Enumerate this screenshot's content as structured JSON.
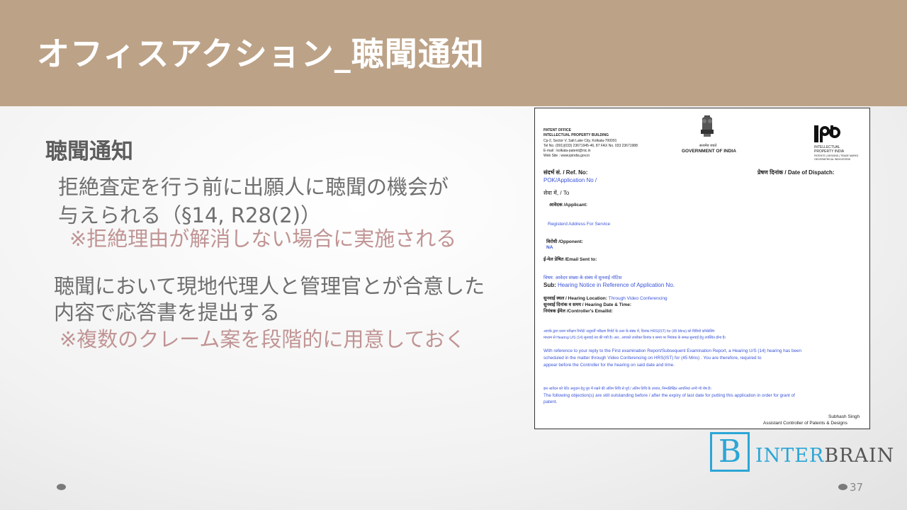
{
  "slide": {
    "title": "オフィスアクション_聴聞通知",
    "section_title": "聴聞通知",
    "body": {
      "line1": "拒絶査定を行う前に出願人に聴聞の機会が",
      "line2": "与えられる（§14, R28(2)）",
      "note1": "※拒絶理由が解消しない場合に実施される",
      "line3": "聴聞において現地代理人と管理官とが合意した",
      "line4": "内容で応答書を提出する",
      "note2": "※複数のクレーム案を段階的に用意しておく"
    },
    "page_number": "37"
  },
  "document": {
    "office_lines": [
      "PATENT OFFICE",
      "INTELLECTUAL PROPERTY BUILDING",
      "Cp-2, Sector V, Salt Lake City, Kolkata-700091",
      "Tel No. (091)(033) 23671945-46, 87 FAX No. 033 23671988",
      "E-mail : kolkata-patent@nic.in",
      "Web Site : www.ipindia.gov.in"
    ],
    "emblem_caption": "सत्यमेव जयते",
    "government": "GOVERNMENT OF INDIA",
    "ip_india_lines": [
      "INTELLECTUAL",
      "PROPERTY INDIA",
      "PATENTS | DESIGNS | TRADE MARKS",
      "GEOGRAPHICAL INDICATIONS"
    ],
    "ref_no": "संदर्भ सं. / Ref. No:",
    "date_of_dispatch": "प्रेषण दिनांक / Date of Dispatch:",
    "application_no": "POK/Application No /",
    "to": "सेवा में, / To",
    "applicant": "आवेदक /Applicant:",
    "registered_address": "Registerd Address For Service",
    "opponent": "विरोधी /Opponent:",
    "opponent_value": "NA",
    "email_sent_to": "ई-मेल प्रेषित /Email Sent to:",
    "subject_hindi": "विषय: आवेदन संख्या                                के संबंध में सुनवाई नोटिस",
    "subject_label": "Sub:",
    "subject_value": "Hearing Notice in Reference of Application No.",
    "hearing_location_label": "सुनवाई स्थल / Hearing Location:",
    "hearing_location_value": "Through Video Conferencing",
    "hearing_date_label": "सुनवाई दिनांक व समय / Hearing Date & Time:",
    "controller_email_label": "नियंत्रक ईमेल /Controller's EmailId:",
    "hindi_para_1": "आपके द्वारा प्रथम परीक्षण रिपोर्ट/ अनुवर्ती परीक्षण रिपोर्ट के उत्तर के संबंध में, दिनांक                                   HRS(IST) for (45 Mins) को विडियो कॉन्फ्रेंसिंग",
    "hindi_para_2": "माध्यम से Hearing U/S (14) सुनवाई तय की गयी है। अत:, आपको उपरोक्त दिनांक व समय पर नियंत्रक के समक्ष सुनवाई हेतु उपस्थित होना है।",
    "english_para": [
      "With reference to your reply to the First examination Report/Subsequent Examination Report, a Hearing U/S (14) hearing has been",
      "scheduled in the matter through Video Conferencing on                               HRS(IST) for (45 Mins) . You are therefore, required to",
      "appear before the Controller for the hearing on said date and time."
    ],
    "hindi_para_3": "इस आवेदन को पेटेंट अनुदान हेतु पूरा में रखने की अंतिम तिथि से पूर्व / अंतिम तिथि के उपरांत, निम्नलिखित आपत्तियां अभी भी शेष हैं।",
    "objection_para": [
      "The following objection(s) are still outstanding before / after the expiry of last date for putting this application in order for grant of",
      "patent."
    ],
    "signatory_name": "Subhash Singh",
    "signatory_title": "Assistant Controller of Patents & Designs"
  },
  "logo": {
    "letter": "B",
    "text_accent": "INTER",
    "text_rest": "BRAIN"
  },
  "colors": {
    "header": "#bca287",
    "note": "#c19494",
    "logo": "#2ba6d6",
    "doc_blue": "#3a54d8"
  }
}
